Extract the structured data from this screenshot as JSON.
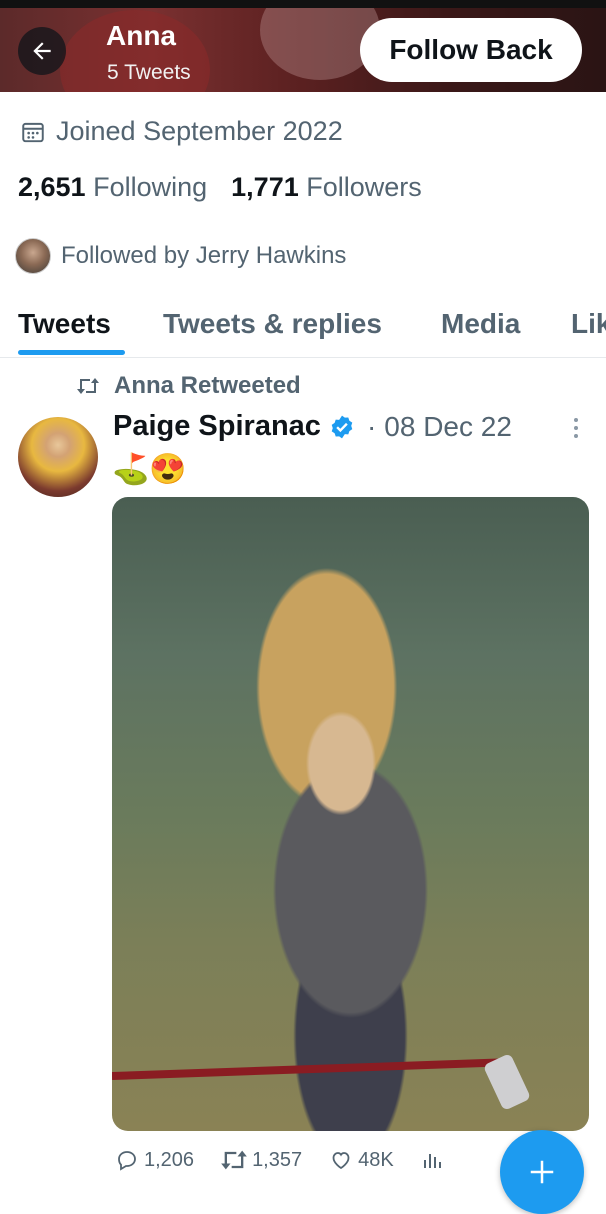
{
  "header": {
    "name": "Anna",
    "tweet_count": "5 Tweets",
    "follow_back_label": "Follow Back",
    "back_icon": "arrow-left-icon"
  },
  "profile": {
    "joined": "Joined September 2022",
    "following_count": "2,651",
    "following_label": "Following",
    "followers_count": "1,771",
    "followers_label": "Followers",
    "followed_by": "Followed by Jerry Hawkins"
  },
  "tabs": [
    {
      "label": "Tweets",
      "active": true
    },
    {
      "label": "Tweets & replies",
      "active": false
    },
    {
      "label": "Media",
      "active": false
    },
    {
      "label": "Lik",
      "active": false
    }
  ],
  "tweet": {
    "retweet_label": "Anna Retweeted",
    "author_name": "Paige Spiranac",
    "separator": "·",
    "date": "08 Dec 22",
    "text": "⛳😍",
    "replies": "1,206",
    "retweets": "1,357",
    "likes": "48K"
  },
  "colors": {
    "accent": "#1d9bf0",
    "text": "#0f1419",
    "muted": "#536471"
  }
}
